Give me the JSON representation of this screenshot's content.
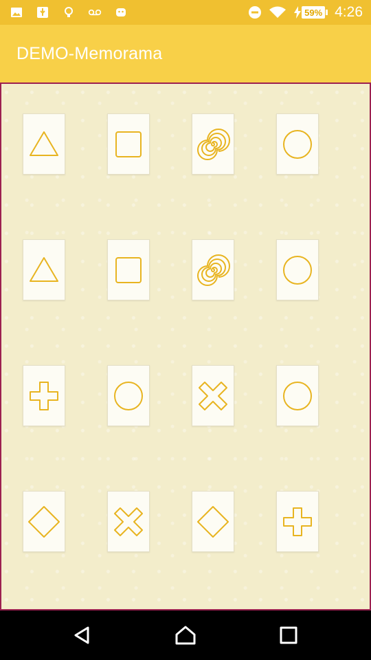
{
  "status_bar": {
    "time": "4:26",
    "battery": "59%",
    "icons": [
      "image-icon",
      "usb-icon",
      "lightbulb-icon",
      "voicemail-icon",
      "android-icon",
      "do-not-disturb-icon",
      "wifi-icon",
      "charging-icon",
      "battery-icon"
    ]
  },
  "app_bar": {
    "title": "DEMO-Memorama"
  },
  "colors": {
    "status": "#F0C030",
    "app_bar": "#F8D048",
    "board": "#F3EDCB",
    "shape_stroke": "#E8B420",
    "border": "#9C2050"
  },
  "board": {
    "rows": 4,
    "columns": 4,
    "cards": [
      [
        "triangle",
        "square",
        "spiral",
        "circle"
      ],
      [
        "triangle",
        "square",
        "spiral",
        "circle"
      ],
      [
        "plus",
        "circle",
        "cross",
        "circle"
      ],
      [
        "diamond",
        "cross",
        "diamond",
        "plus"
      ]
    ]
  },
  "nav_bar": {
    "buttons": [
      "back",
      "home",
      "recents"
    ]
  }
}
